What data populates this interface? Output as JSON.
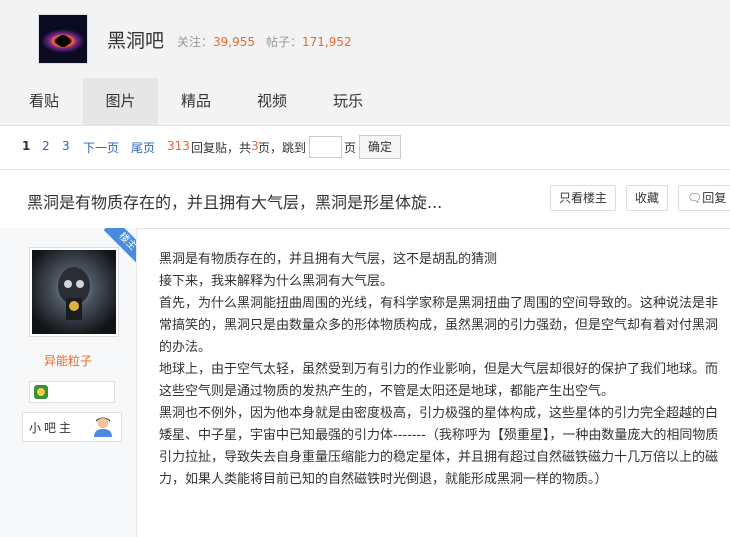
{
  "forum": {
    "name": "黑洞吧",
    "follow_label": "关注：",
    "follow_count": "39,955",
    "posts_label": "帖子：",
    "posts_count": "171,952"
  },
  "nav": {
    "tabs": [
      {
        "label": "看贴"
      },
      {
        "label": "图片"
      },
      {
        "label": "精品"
      },
      {
        "label": "视频"
      },
      {
        "label": "玩乐"
      }
    ]
  },
  "pager": {
    "pages": [
      "1",
      "2",
      "3"
    ],
    "next": "下一页",
    "last": "尾页",
    "reply_count": "313",
    "reply_label": "回复贴，共",
    "total_pages": "3",
    "pages_suffix": "页，跳到",
    "page_unit": "页",
    "go_button": "确定"
  },
  "thread": {
    "title": "黑洞是有物质存在的，并且拥有大气层，黑洞是形星体旋...",
    "only_author_button": "只看楼主",
    "collect_button": "收藏",
    "reply_button": "回复"
  },
  "author": {
    "badge": "楼主",
    "name": "异能粒子",
    "role": "小吧主"
  },
  "post": {
    "paragraphs": [
      "黑洞是有物质存在的，并且拥有大气层，这不是胡乱的猜测",
      "接下来，我来解释为什么黑洞有大气层。",
      "首先，为什么黑洞能扭曲周围的光线，有科学家称是黑洞扭曲了周围的空间导致的。这种说法是非常搞笑的，黑洞只是由数量众多的形体物质构成，虽然黑洞的引力强劲，但是空气却有着对付黑洞的办法。",
      "地球上，由于空气太轻，虽然受到万有引力的作业影响，但是大气层却很好的保护了我们地球。而这些空气则是通过物质的发热产生的，不管是太阳还是地球，都能产生出空气。",
      "黑洞也不例外，因为他本身就是由密度极高，引力极强的星体构成，这些星体的引力完全超越的白矮星、中子星，宇宙中已知最强的引力体-------（我称呼为【殒重星】，一种由数量庞大的相同物质引力拉扯，导致失去自身重量压缩能力的稳定星体，并且拥有超过自然磁铁磁力十几万倍以上的磁力，如果人类能将目前已知的自然磁铁时光倒退，就能形成黑洞一样的物质。）"
    ]
  }
}
